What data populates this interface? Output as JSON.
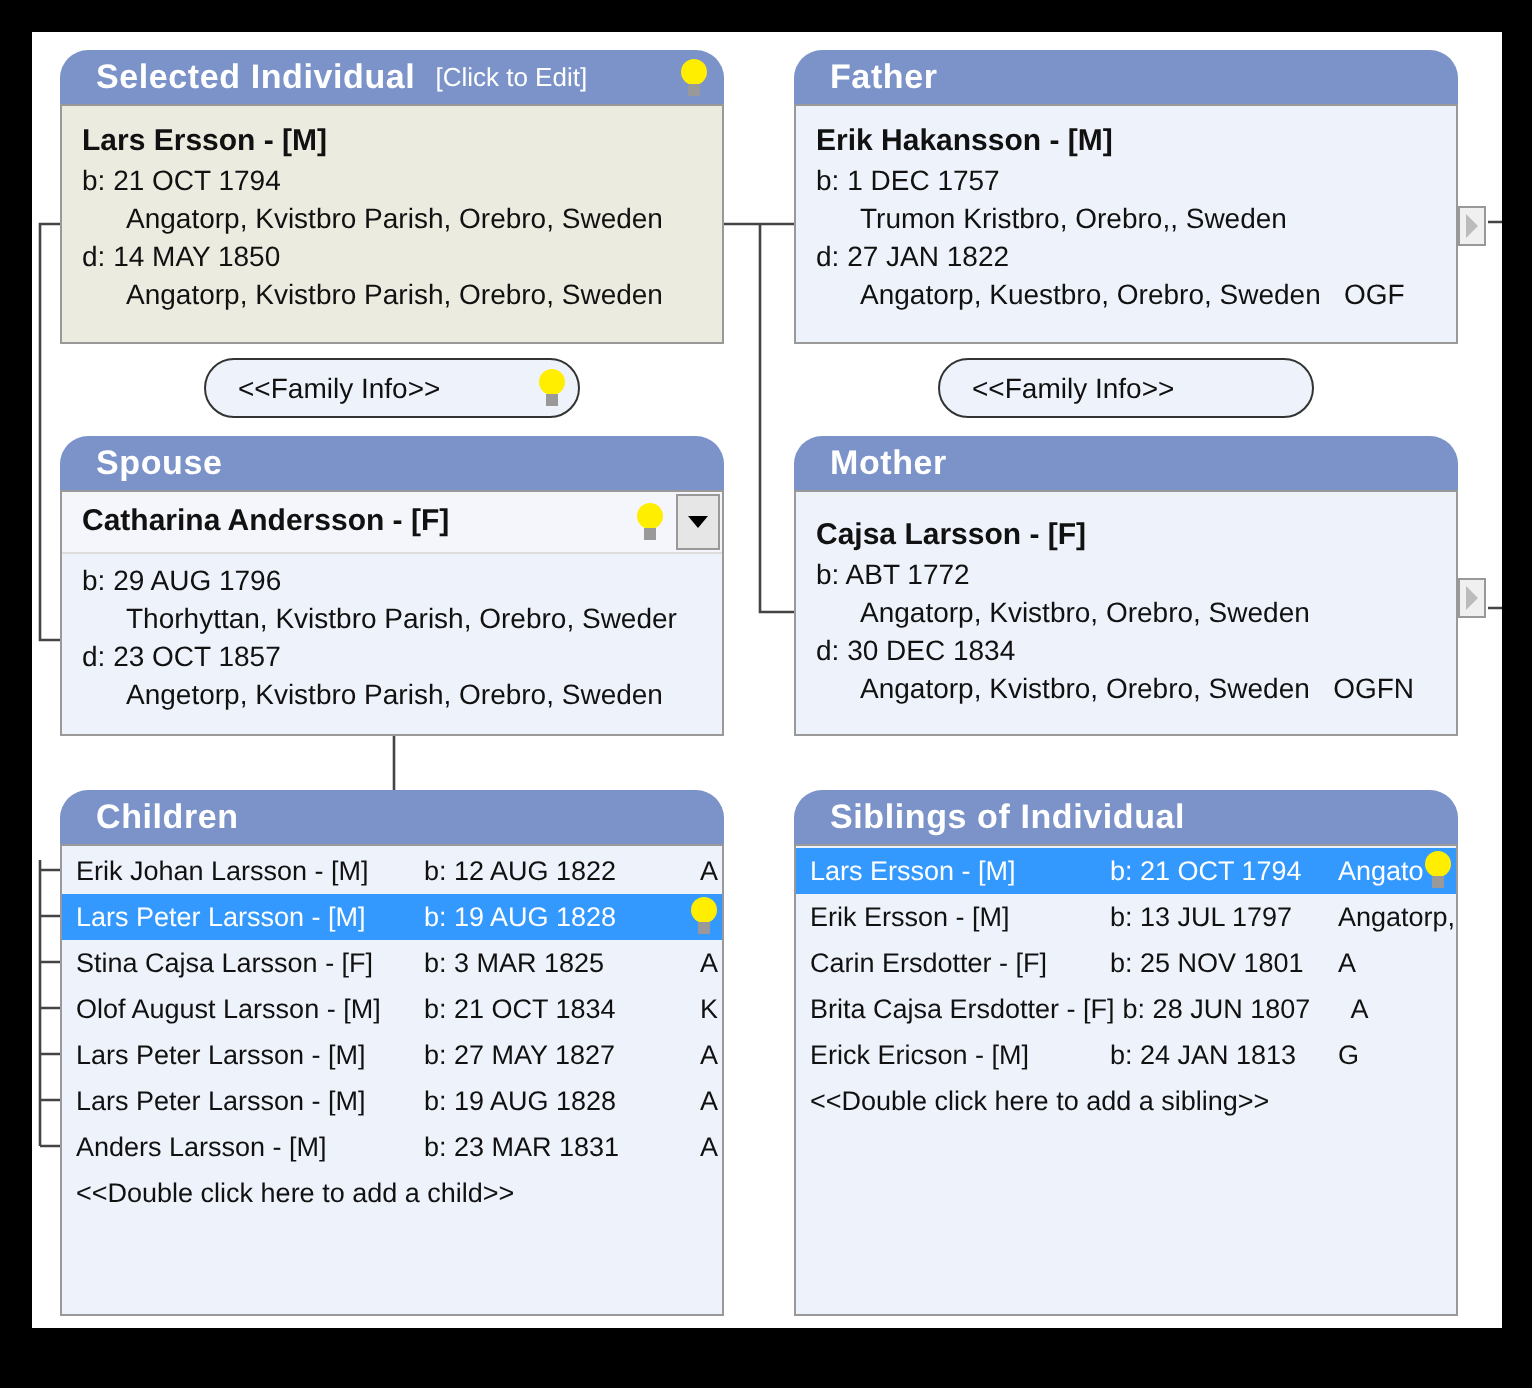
{
  "selected_individual": {
    "title": "Selected Individual",
    "edit_hint": "[Click to Edit]",
    "name": "Lars Ersson - [M]",
    "lines": [
      {
        "kind": "date",
        "text": "b: 21 OCT 1794"
      },
      {
        "kind": "place",
        "text": "Angatorp, Kvistbro Parish, Orebro, Sweden"
      },
      {
        "kind": "date",
        "text": "d: 14 MAY 1850"
      },
      {
        "kind": "place",
        "text": "Angatorp, Kvistbro Parish, Orebro, Sweden"
      }
    ]
  },
  "father": {
    "title": "Father",
    "name": "Erik Hakansson - [M]",
    "lines": [
      {
        "kind": "date",
        "text": "b: 1 DEC 1757"
      },
      {
        "kind": "place",
        "text": "Trumon Kristbro, Orebro,, Sweden"
      },
      {
        "kind": "date",
        "text": "d: 27 JAN 1822"
      },
      {
        "kind": "place",
        "text": "Angatorp, Kuestbro, Orebro, Sweden   OGF"
      }
    ]
  },
  "family_info": [
    "<<Family Info>>",
    "<<Family Info>>"
  ],
  "spouse": {
    "title": "Spouse",
    "name": "Catharina Andersson - [F]",
    "lines": [
      {
        "kind": "date",
        "text": "b: 29 AUG 1796"
      },
      {
        "kind": "place",
        "text": "Thorhyttan, Kvistbro Parish, Orebro, Sweder"
      },
      {
        "kind": "date",
        "text": "d: 23 OCT 1857"
      },
      {
        "kind": "place",
        "text": "Angetorp, Kvistbro Parish, Orebro, Sweden"
      }
    ]
  },
  "mother": {
    "title": "Mother",
    "name": "Cajsa Larsson - [F]",
    "lines": [
      {
        "kind": "date",
        "text": "b: ABT 1772"
      },
      {
        "kind": "place",
        "text": "Angatorp, Kvistbro, Orebro, Sweden"
      },
      {
        "kind": "date",
        "text": "d: 30 DEC 1834"
      },
      {
        "kind": "place",
        "text": "Angatorp, Kvistbro, Orebro, Sweden   OGFN"
      }
    ]
  },
  "children": {
    "title": "Children",
    "rows": [
      {
        "name": "Erik Johan Larsson - [M]",
        "birth": "b: 12 AUG 1822",
        "place": "A",
        "selected": false
      },
      {
        "name": "Lars Peter Larsson - [M]",
        "birth": "b: 19 AUG 1828",
        "selected": true
      },
      {
        "name": "Stina Cajsa Larsson - [F]",
        "birth": "b: 3 MAR 1825",
        "place": "A",
        "selected": false
      },
      {
        "name": "Olof August Larsson - [M]",
        "birth": "b: 21 OCT 1834",
        "place": "K",
        "selected": false
      },
      {
        "name": "Lars Peter Larsson - [M]",
        "birth": "b: 27 MAY 1827",
        "place": "A",
        "selected": false
      },
      {
        "name": "Lars Peter Larsson - [M]",
        "birth": "b: 19 AUG 1828",
        "place": "A",
        "selected": false
      },
      {
        "name": "Anders Larsson - [M]",
        "birth": "b: 23 MAR 1831",
        "place": "A",
        "selected": false
      }
    ],
    "add_hint": "<<Double click here to add a child>>"
  },
  "siblings": {
    "title": "Siblings of Individual",
    "rows": [
      {
        "name": "Lars Ersson - [M]",
        "birth": "b: 21 OCT 1794",
        "place": "Angato",
        "selected": true
      },
      {
        "name": "Erik Ersson - [M]",
        "birth": "b: 13 JUL 1797",
        "place": "Angatorp,",
        "selected": false
      },
      {
        "name": "Carin Ersdotter - [F]",
        "birth": "b: 25 NOV 1801",
        "place": "A",
        "selected": false
      },
      {
        "name": "Brita Cajsa Ersdotter - [F]",
        "birth": "b: 28 JUN 1807",
        "place": "A",
        "selected": false
      },
      {
        "name": "Erick Ericson - [M]",
        "birth": "b: 24 JAN 1813",
        "place": "G",
        "selected": false
      }
    ],
    "add_hint": "<<Double click here to add a sibling>>"
  }
}
